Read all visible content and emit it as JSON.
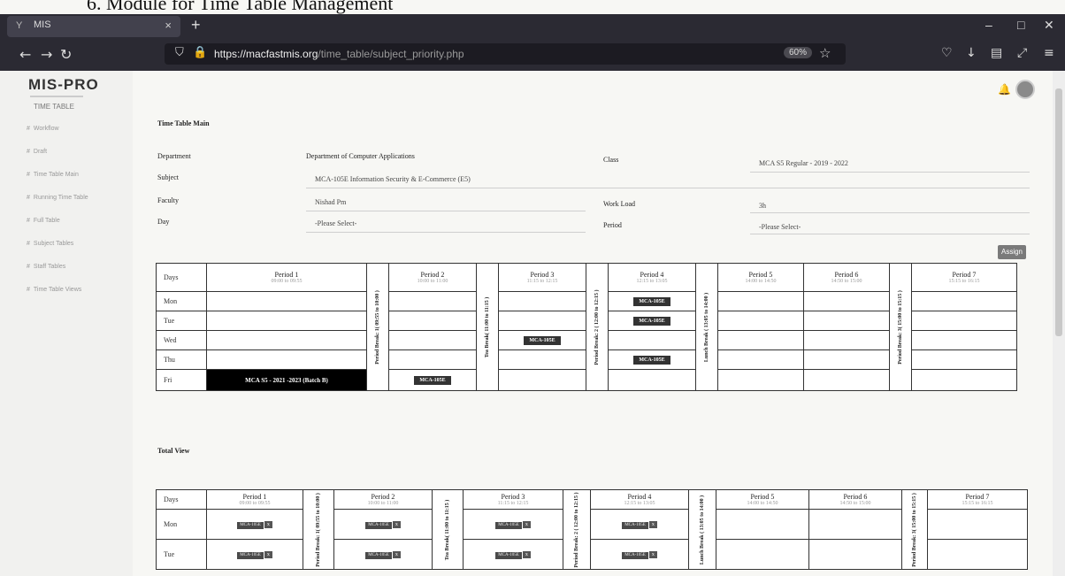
{
  "document": {
    "heading": "6.   Module for Time Table Management"
  },
  "browser": {
    "tab_title": "MIS",
    "url_host": "https://macfastmis.org",
    "url_path": "/time_table/subject_priority.php",
    "zoom": "60%"
  },
  "sidebar": {
    "logo": "MIS-PRO",
    "title": "TIME TABLE",
    "items": [
      {
        "label": "Workflow"
      },
      {
        "label": "Draft"
      },
      {
        "label": "Time Table Main"
      },
      {
        "label": "Running Time Table"
      },
      {
        "label": "Full Table"
      },
      {
        "label": "Subject Tables"
      },
      {
        "label": "Staff Tables"
      },
      {
        "label": "Time Table Views"
      }
    ]
  },
  "form": {
    "card_title": "Time Table Main",
    "department_label": "Department",
    "department_value": "Department of Computer Applications",
    "class_label": "Class",
    "class_value": "MCA S5 Regular - 2019 - 2022",
    "subject_label": "Subject",
    "subject_value": "MCA-105E Information Security & E-Commerce (E5)",
    "faculty_label": "Faculty",
    "faculty_value": "Nishad Pm",
    "workload_label": "Work Load",
    "workload_value": "3h",
    "day_label": "Day",
    "day_value": "-Please Select-",
    "period_label": "Period",
    "period_value": "-Please Select-",
    "assign_label": "Assign"
  },
  "timetable": {
    "days_header": "Days",
    "periods": [
      {
        "title": "Period 1",
        "time": "09:00 to 09:55"
      },
      {
        "title": "Period 2",
        "time": "10:00 to 11:00"
      },
      {
        "title": "Period 3",
        "time": "11:15 to 12:15"
      },
      {
        "title": "Period 4",
        "time": "12:15 to 13:05"
      },
      {
        "title": "Period 5",
        "time": "14:00 to 14:50"
      },
      {
        "title": "Period 6",
        "time": "14:50 to 15:00"
      },
      {
        "title": "Period 7",
        "time": "15:15 to 16:15"
      }
    ],
    "breaks": [
      "Period Break: 1( 09:55 to 10:00 )",
      "Tea Break( 11:00 to 11:15 )",
      "Period Break: 2 ( 12:00 to 12:15 )",
      "Lunch Break ( 13:05 to 14:00 )",
      "Period Break: 3( 15:00 to 15:15 )"
    ],
    "days": [
      "Mon",
      "Tue",
      "Wed",
      "Thu",
      "Fri"
    ],
    "slot_short": "MCA-105E",
    "fri_batch": "MCA S5 - 2021 -2023 (Batch B)"
  },
  "total_view": {
    "title": "Total View",
    "chip_label": "MCA-105E",
    "chip_sub": "NP",
    "chip_x": "x",
    "days": [
      "Mon",
      "Tue"
    ]
  }
}
